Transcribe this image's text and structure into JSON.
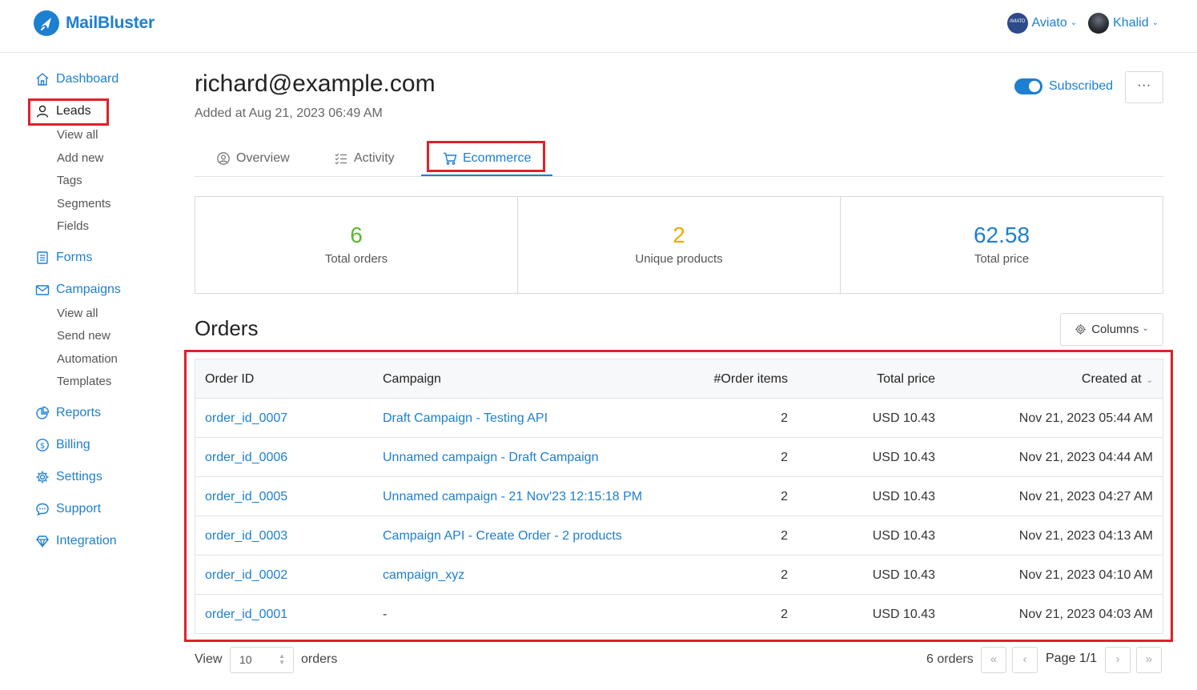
{
  "brand": {
    "name": "MailBluster"
  },
  "top_bar": {
    "org": {
      "name": "Aviato",
      "avatar_text": "AVIATO"
    },
    "user": {
      "name": "Khalid"
    }
  },
  "sidebar": {
    "dashboard": "Dashboard",
    "leads": {
      "label": "Leads",
      "sub": [
        "View all",
        "Add new",
        "Tags",
        "Segments",
        "Fields"
      ]
    },
    "forms": "Forms",
    "campaigns": {
      "label": "Campaigns",
      "sub": [
        "View all",
        "Send new",
        "Automation",
        "Templates"
      ]
    },
    "reports": "Reports",
    "billing": "Billing",
    "settings": "Settings",
    "support": "Support",
    "integration": "Integration"
  },
  "lead": {
    "email": "richard@example.com",
    "added_at": "Added at Aug 21, 2023 06:49 AM",
    "subscribed_label": "Subscribed",
    "subscribed": true,
    "more_label": "···"
  },
  "tabs": [
    "Overview",
    "Activity",
    "Ecommerce"
  ],
  "active_tab": "Ecommerce",
  "stats": [
    {
      "value": "6",
      "label": "Total orders",
      "color": "#5cb82e"
    },
    {
      "value": "2",
      "label": "Unique products",
      "color": "#f2a900"
    },
    {
      "value": "62.58",
      "label": "Total price",
      "color": "#1d7fd0"
    }
  ],
  "orders": {
    "title": "Orders",
    "columns_button": "Columns",
    "headers": [
      "Order ID",
      "Campaign",
      "#Order items",
      "Total price",
      "Created at"
    ],
    "rows": [
      {
        "id": "order_id_0007",
        "campaign": "Draft Campaign - Testing API",
        "items": "2",
        "price": "USD 10.43",
        "created": "Nov 21, 2023 05:44 AM"
      },
      {
        "id": "order_id_0006",
        "campaign": "Unnamed campaign - Draft Campaign",
        "items": "2",
        "price": "USD 10.43",
        "created": "Nov 21, 2023 04:44 AM"
      },
      {
        "id": "order_id_0005",
        "campaign": "Unnamed campaign - 21 Nov'23 12:15:18 PM",
        "items": "2",
        "price": "USD 10.43",
        "created": "Nov 21, 2023 04:27 AM"
      },
      {
        "id": "order_id_0003",
        "campaign": "Campaign API - Create Order - 2 products",
        "items": "2",
        "price": "USD 10.43",
        "created": "Nov 21, 2023 04:13 AM"
      },
      {
        "id": "order_id_0002",
        "campaign": "campaign_xyz",
        "items": "2",
        "price": "USD 10.43",
        "created": "Nov 21, 2023 04:10 AM"
      },
      {
        "id": "order_id_0001",
        "campaign": "-",
        "items": "2",
        "price": "USD 10.43",
        "created": "Nov 21, 2023 04:03 AM"
      }
    ]
  },
  "pagination": {
    "view_label": "View",
    "per_page": "10",
    "orders_label": "orders",
    "count": "6 orders",
    "page": "Page 1/1",
    "first": "«",
    "prev": "‹",
    "next": "›",
    "last": "»"
  }
}
